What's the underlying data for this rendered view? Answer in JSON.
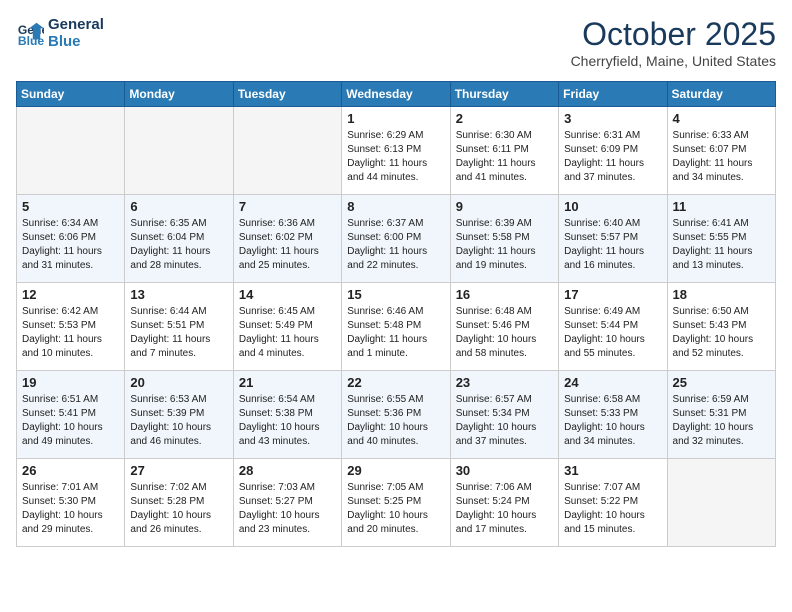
{
  "header": {
    "logo_line1": "General",
    "logo_line2": "Blue",
    "month": "October 2025",
    "location": "Cherryfield, Maine, United States"
  },
  "weekdays": [
    "Sunday",
    "Monday",
    "Tuesday",
    "Wednesday",
    "Thursday",
    "Friday",
    "Saturday"
  ],
  "weeks": [
    [
      {
        "day": "",
        "info": ""
      },
      {
        "day": "",
        "info": ""
      },
      {
        "day": "",
        "info": ""
      },
      {
        "day": "1",
        "info": "Sunrise: 6:29 AM\nSunset: 6:13 PM\nDaylight: 11 hours\nand 44 minutes."
      },
      {
        "day": "2",
        "info": "Sunrise: 6:30 AM\nSunset: 6:11 PM\nDaylight: 11 hours\nand 41 minutes."
      },
      {
        "day": "3",
        "info": "Sunrise: 6:31 AM\nSunset: 6:09 PM\nDaylight: 11 hours\nand 37 minutes."
      },
      {
        "day": "4",
        "info": "Sunrise: 6:33 AM\nSunset: 6:07 PM\nDaylight: 11 hours\nand 34 minutes."
      }
    ],
    [
      {
        "day": "5",
        "info": "Sunrise: 6:34 AM\nSunset: 6:06 PM\nDaylight: 11 hours\nand 31 minutes."
      },
      {
        "day": "6",
        "info": "Sunrise: 6:35 AM\nSunset: 6:04 PM\nDaylight: 11 hours\nand 28 minutes."
      },
      {
        "day": "7",
        "info": "Sunrise: 6:36 AM\nSunset: 6:02 PM\nDaylight: 11 hours\nand 25 minutes."
      },
      {
        "day": "8",
        "info": "Sunrise: 6:37 AM\nSunset: 6:00 PM\nDaylight: 11 hours\nand 22 minutes."
      },
      {
        "day": "9",
        "info": "Sunrise: 6:39 AM\nSunset: 5:58 PM\nDaylight: 11 hours\nand 19 minutes."
      },
      {
        "day": "10",
        "info": "Sunrise: 6:40 AM\nSunset: 5:57 PM\nDaylight: 11 hours\nand 16 minutes."
      },
      {
        "day": "11",
        "info": "Sunrise: 6:41 AM\nSunset: 5:55 PM\nDaylight: 11 hours\nand 13 minutes."
      }
    ],
    [
      {
        "day": "12",
        "info": "Sunrise: 6:42 AM\nSunset: 5:53 PM\nDaylight: 11 hours\nand 10 minutes."
      },
      {
        "day": "13",
        "info": "Sunrise: 6:44 AM\nSunset: 5:51 PM\nDaylight: 11 hours\nand 7 minutes."
      },
      {
        "day": "14",
        "info": "Sunrise: 6:45 AM\nSunset: 5:49 PM\nDaylight: 11 hours\nand 4 minutes."
      },
      {
        "day": "15",
        "info": "Sunrise: 6:46 AM\nSunset: 5:48 PM\nDaylight: 11 hours\nand 1 minute."
      },
      {
        "day": "16",
        "info": "Sunrise: 6:48 AM\nSunset: 5:46 PM\nDaylight: 10 hours\nand 58 minutes."
      },
      {
        "day": "17",
        "info": "Sunrise: 6:49 AM\nSunset: 5:44 PM\nDaylight: 10 hours\nand 55 minutes."
      },
      {
        "day": "18",
        "info": "Sunrise: 6:50 AM\nSunset: 5:43 PM\nDaylight: 10 hours\nand 52 minutes."
      }
    ],
    [
      {
        "day": "19",
        "info": "Sunrise: 6:51 AM\nSunset: 5:41 PM\nDaylight: 10 hours\nand 49 minutes."
      },
      {
        "day": "20",
        "info": "Sunrise: 6:53 AM\nSunset: 5:39 PM\nDaylight: 10 hours\nand 46 minutes."
      },
      {
        "day": "21",
        "info": "Sunrise: 6:54 AM\nSunset: 5:38 PM\nDaylight: 10 hours\nand 43 minutes."
      },
      {
        "day": "22",
        "info": "Sunrise: 6:55 AM\nSunset: 5:36 PM\nDaylight: 10 hours\nand 40 minutes."
      },
      {
        "day": "23",
        "info": "Sunrise: 6:57 AM\nSunset: 5:34 PM\nDaylight: 10 hours\nand 37 minutes."
      },
      {
        "day": "24",
        "info": "Sunrise: 6:58 AM\nSunset: 5:33 PM\nDaylight: 10 hours\nand 34 minutes."
      },
      {
        "day": "25",
        "info": "Sunrise: 6:59 AM\nSunset: 5:31 PM\nDaylight: 10 hours\nand 32 minutes."
      }
    ],
    [
      {
        "day": "26",
        "info": "Sunrise: 7:01 AM\nSunset: 5:30 PM\nDaylight: 10 hours\nand 29 minutes."
      },
      {
        "day": "27",
        "info": "Sunrise: 7:02 AM\nSunset: 5:28 PM\nDaylight: 10 hours\nand 26 minutes."
      },
      {
        "day": "28",
        "info": "Sunrise: 7:03 AM\nSunset: 5:27 PM\nDaylight: 10 hours\nand 23 minutes."
      },
      {
        "day": "29",
        "info": "Sunrise: 7:05 AM\nSunset: 5:25 PM\nDaylight: 10 hours\nand 20 minutes."
      },
      {
        "day": "30",
        "info": "Sunrise: 7:06 AM\nSunset: 5:24 PM\nDaylight: 10 hours\nand 17 minutes."
      },
      {
        "day": "31",
        "info": "Sunrise: 7:07 AM\nSunset: 5:22 PM\nDaylight: 10 hours\nand 15 minutes."
      },
      {
        "day": "",
        "info": ""
      }
    ]
  ]
}
